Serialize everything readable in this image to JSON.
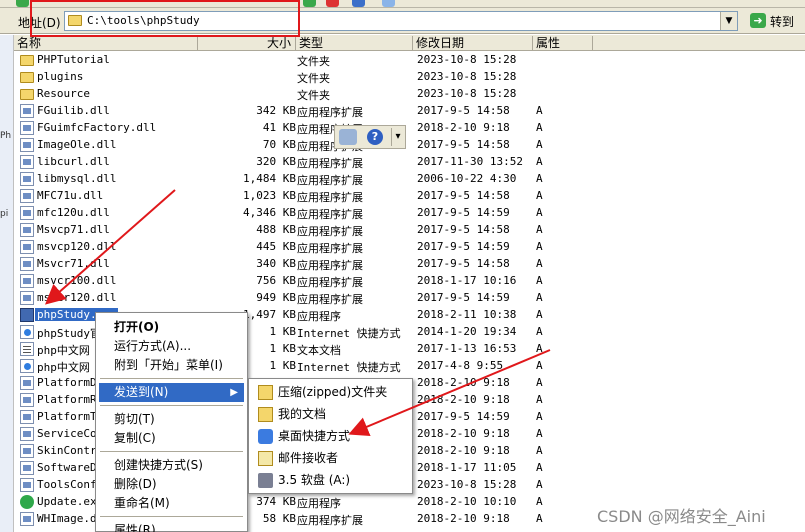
{
  "address_bar": {
    "label": "地址(D)",
    "path": "C:\\tools\\phpStudy",
    "go_label": "转到"
  },
  "columns": {
    "name": "名称",
    "size": "大小",
    "type": "类型",
    "modified": "修改日期",
    "attributes": "属性"
  },
  "files": [
    {
      "name": "PHPTutorial",
      "size": "",
      "type": "文件夹",
      "modified": "2023-10-8 15:28",
      "attr": "",
      "icon": "folder-icon"
    },
    {
      "name": "plugins",
      "size": "",
      "type": "文件夹",
      "modified": "2023-10-8 15:28",
      "attr": "",
      "icon": "folder-icon"
    },
    {
      "name": "Resource",
      "size": "",
      "type": "文件夹",
      "modified": "2023-10-8 15:28",
      "attr": "",
      "icon": "folder-icon"
    },
    {
      "name": "FGuilib.dll",
      "size": "342 KB",
      "type": "应用程序扩展",
      "modified": "2017-9-5 14:58",
      "attr": "A",
      "icon": "dll-icon"
    },
    {
      "name": "FGuimfcFactory.dll",
      "size": "41 KB",
      "type": "应用程序扩展",
      "modified": "2018-2-10 9:18",
      "attr": "A",
      "icon": "dll-icon"
    },
    {
      "name": "ImageOle.dll",
      "size": "70 KB",
      "type": "应用程序扩展",
      "modified": "2017-9-5 14:58",
      "attr": "A",
      "icon": "dll-icon"
    },
    {
      "name": "libcurl.dll",
      "size": "320 KB",
      "type": "应用程序扩展",
      "modified": "2017-11-30 13:52",
      "attr": "A",
      "icon": "dll-icon"
    },
    {
      "name": "libmysql.dll",
      "size": "1,484 KB",
      "type": "应用程序扩展",
      "modified": "2006-10-22 4:30",
      "attr": "A",
      "icon": "dll-icon"
    },
    {
      "name": "MFC71u.dll",
      "size": "1,023 KB",
      "type": "应用程序扩展",
      "modified": "2017-9-5 14:58",
      "attr": "A",
      "icon": "dll-icon"
    },
    {
      "name": "mfc120u.dll",
      "size": "4,346 KB",
      "type": "应用程序扩展",
      "modified": "2017-9-5 14:59",
      "attr": "A",
      "icon": "dll-icon"
    },
    {
      "name": "Msvcp71.dll",
      "size": "488 KB",
      "type": "应用程序扩展",
      "modified": "2017-9-5 14:58",
      "attr": "A",
      "icon": "dll-icon"
    },
    {
      "name": "msvcp120.dll",
      "size": "445 KB",
      "type": "应用程序扩展",
      "modified": "2017-9-5 14:59",
      "attr": "A",
      "icon": "dll-icon"
    },
    {
      "name": "Msvcr71.dll",
      "size": "340 KB",
      "type": "应用程序扩展",
      "modified": "2017-9-5 14:58",
      "attr": "A",
      "icon": "dll-icon"
    },
    {
      "name": "msvcr100.dll",
      "size": "756 KB",
      "type": "应用程序扩展",
      "modified": "2018-1-17 10:16",
      "attr": "A",
      "icon": "dll-icon"
    },
    {
      "name": "msvcr120.dll",
      "size": "949 KB",
      "type": "应用程序扩展",
      "modified": "2017-9-5 14:59",
      "attr": "A",
      "icon": "dll-icon"
    },
    {
      "name": "phpStudy.exe",
      "size": "1,497 KB",
      "type": "应用程序",
      "modified": "2018-2-11 10:38",
      "attr": "A",
      "icon": "exe-icon",
      "selected": true
    },
    {
      "name": "phpStudy官",
      "size": "1 KB",
      "type": "Internet 快捷方式",
      "modified": "2014-1-20 19:34",
      "attr": "A",
      "icon": "url-icon"
    },
    {
      "name": "php中文网",
      "size": "1 KB",
      "type": "文本文档",
      "modified": "2017-1-13 16:53",
      "attr": "A",
      "icon": "txt-icon"
    },
    {
      "name": "php中文网",
      "size": "1 KB",
      "type": "Internet 快捷方式",
      "modified": "2017-4-8 9:55",
      "attr": "A",
      "icon": "url-icon"
    },
    {
      "name": "PlatformD",
      "size": "",
      "type": "",
      "modified": "2018-2-10 9:18",
      "attr": "A",
      "icon": "dll-icon"
    },
    {
      "name": "PlatformRe",
      "size": "",
      "type": "",
      "modified": "2018-2-10 9:18",
      "attr": "A",
      "icon": "dll-icon"
    },
    {
      "name": "PlatformTo",
      "size": "",
      "type": "",
      "modified": "2017-9-5 14:59",
      "attr": "A",
      "icon": "dll-icon"
    },
    {
      "name": "ServiceCor",
      "size": "",
      "type": "",
      "modified": "2018-2-10 9:18",
      "attr": "A",
      "icon": "dll-icon"
    },
    {
      "name": "SkinContro",
      "size": "",
      "type": "",
      "modified": "2018-2-10 9:18",
      "attr": "A",
      "icon": "dll-icon"
    },
    {
      "name": "SoftwareDe",
      "size": "",
      "type": "",
      "modified": "2018-1-17 11:05",
      "attr": "A",
      "icon": "dll-icon"
    },
    {
      "name": "ToolsConfi",
      "size": "",
      "type": "",
      "modified": "2023-10-8 15:28",
      "attr": "A",
      "icon": "dll-icon"
    },
    {
      "name": "Update.exe",
      "size": "374 KB",
      "type": "应用程序",
      "modified": "2018-2-10 10:10",
      "attr": "A",
      "icon": "green-icon"
    },
    {
      "name": "WHImage.dl",
      "size": "58 KB",
      "type": "应用程序扩展",
      "modified": "2018-2-10 9:18",
      "attr": "A",
      "icon": "dll-icon"
    }
  ],
  "context_menu": [
    {
      "label": "打开(O)",
      "bold": true
    },
    {
      "label": "运行方式(A)..."
    },
    {
      "label": "附到「开始」菜单(I)"
    },
    {
      "sep": true
    },
    {
      "label": "发送到(N)",
      "highlighted": true,
      "submenu": true
    },
    {
      "sep": true
    },
    {
      "label": "剪切(T)"
    },
    {
      "label": "复制(C)"
    },
    {
      "sep": true
    },
    {
      "label": "创建快捷方式(S)"
    },
    {
      "label": "删除(D)"
    },
    {
      "label": "重命名(M)"
    },
    {
      "sep": true
    },
    {
      "label": "属性(R)"
    }
  ],
  "send_to_menu": [
    {
      "label": "压缩(zipped)文件夹",
      "icon": "zip-folder-icon"
    },
    {
      "label": "我的文档",
      "icon": "my-documents-icon"
    },
    {
      "label": "桌面快捷方式",
      "icon": "desktop-shortcut-icon"
    },
    {
      "label": "邮件接收者",
      "icon": "mail-recipient-icon"
    },
    {
      "label": "3.5 软盘 (A:)",
      "icon": "floppy-icon"
    }
  ],
  "watermark": "CSDN @网络安全_Aini",
  "annotation_color": "#e0181b",
  "selection_color": "#316ac5"
}
